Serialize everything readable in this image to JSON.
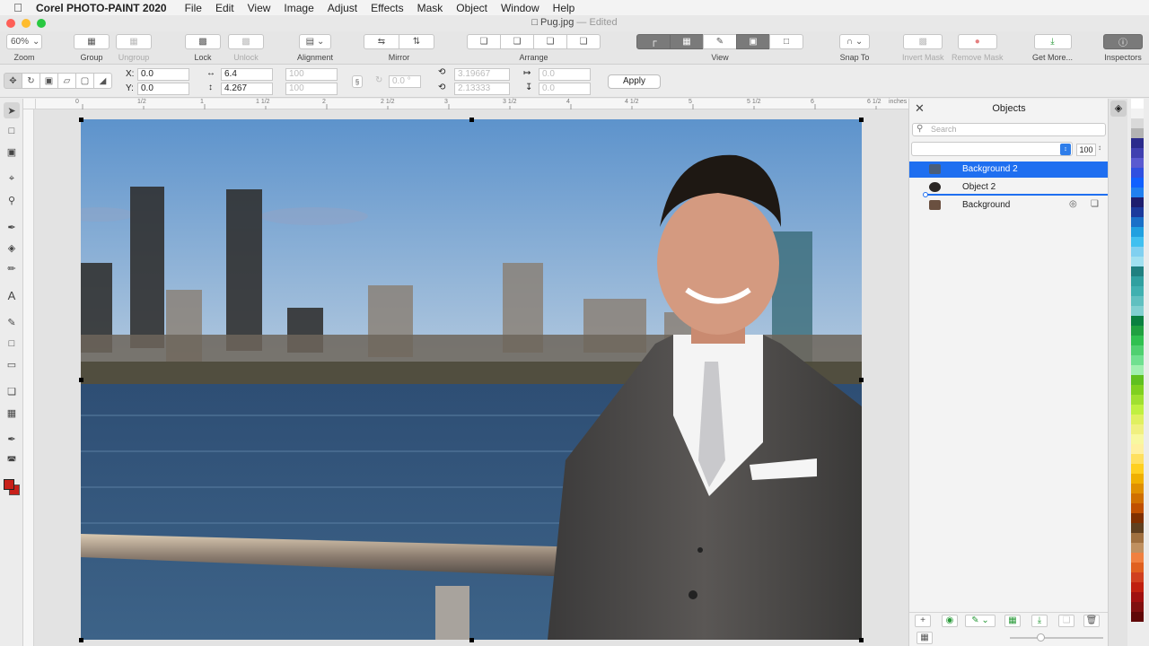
{
  "menubar": {
    "app_name": "Corel PHOTO-PAINT 2020",
    "items": [
      "File",
      "Edit",
      "View",
      "Image",
      "Adjust",
      "Effects",
      "Mask",
      "Object",
      "Window",
      "Help"
    ]
  },
  "window": {
    "title": "Pug.jpg",
    "status": "— Edited"
  },
  "toolbar": {
    "zoom_value": "60%",
    "zoom_label": "Zoom",
    "group_label": "Group",
    "ungroup_label": "Ungroup",
    "lock_label": "Lock",
    "unlock_label": "Unlock",
    "alignment_label": "Alignment",
    "mirror_label": "Mirror",
    "arrange_label": "Arrange",
    "view_label": "View",
    "snap_label": "Snap To",
    "invert_mask_label": "Invert Mask",
    "remove_mask_label": "Remove Mask",
    "get_more_label": "Get More...",
    "inspectors_label": "Inspectors"
  },
  "propbar": {
    "x_label": "X:",
    "y_label": "Y:",
    "x_value": "0.0",
    "y_value": "0.0",
    "width_value": "6.4",
    "height_value": "4.267",
    "scale_w": "100",
    "scale_h": "100",
    "rotation_value": "0.0 °",
    "center_x": "3.19667",
    "center_y": "2.13333",
    "skew_h": "0.0",
    "skew_v": "0.0",
    "apply_label": "Apply"
  },
  "ruler": {
    "unit": "inches",
    "ticks": [
      "0",
      "1/2",
      "1",
      "1 1/2",
      "2",
      "2 1/2",
      "3",
      "3 1/2",
      "4",
      "4 1/2",
      "5",
      "5 1/2",
      "6",
      "6 1/2"
    ]
  },
  "objects_panel": {
    "title": "Objects",
    "search_placeholder": "Search",
    "opacity": "100",
    "layers": [
      {
        "name": "Background 2",
        "selected": true
      },
      {
        "name": "Object 2",
        "selected": false
      },
      {
        "name": "Background",
        "selected": false
      }
    ]
  },
  "colors": {
    "accent": "#1f6ff0",
    "primary_color": "#c8201a",
    "secondary_color": "#000000",
    "palette": [
      "#ffffff",
      "#f2f2f2",
      "#d9d9d9",
      "#b3b3b3",
      "#2b2b8c",
      "#4040b0",
      "#5a5ad0",
      "#3050e0",
      "#1060ff",
      "#2080f0",
      "#1e1e6e",
      "#1c3a9c",
      "#1a70c8",
      "#20a0e0",
      "#40c0f0",
      "#80d0f0",
      "#a0e0f0",
      "#208080",
      "#30a0a0",
      "#40b0b0",
      "#60c0c0",
      "#80d0d0",
      "#0a8040",
      "#20a040",
      "#30c050",
      "#50d070",
      "#70e090",
      "#a0f0b0",
      "#60c020",
      "#80d020",
      "#a0e030",
      "#c0f040",
      "#e0f060",
      "#f0f080",
      "#f8f8a0",
      "#fff0a0",
      "#ffe060",
      "#ffd020",
      "#f0b000",
      "#e09000",
      "#d07000",
      "#c05000",
      "#803000",
      "#604020",
      "#a07040",
      "#c09060",
      "#f08040",
      "#e06020",
      "#d04020",
      "#c02010",
      "#a01010",
      "#801010",
      "#600808"
    ]
  }
}
